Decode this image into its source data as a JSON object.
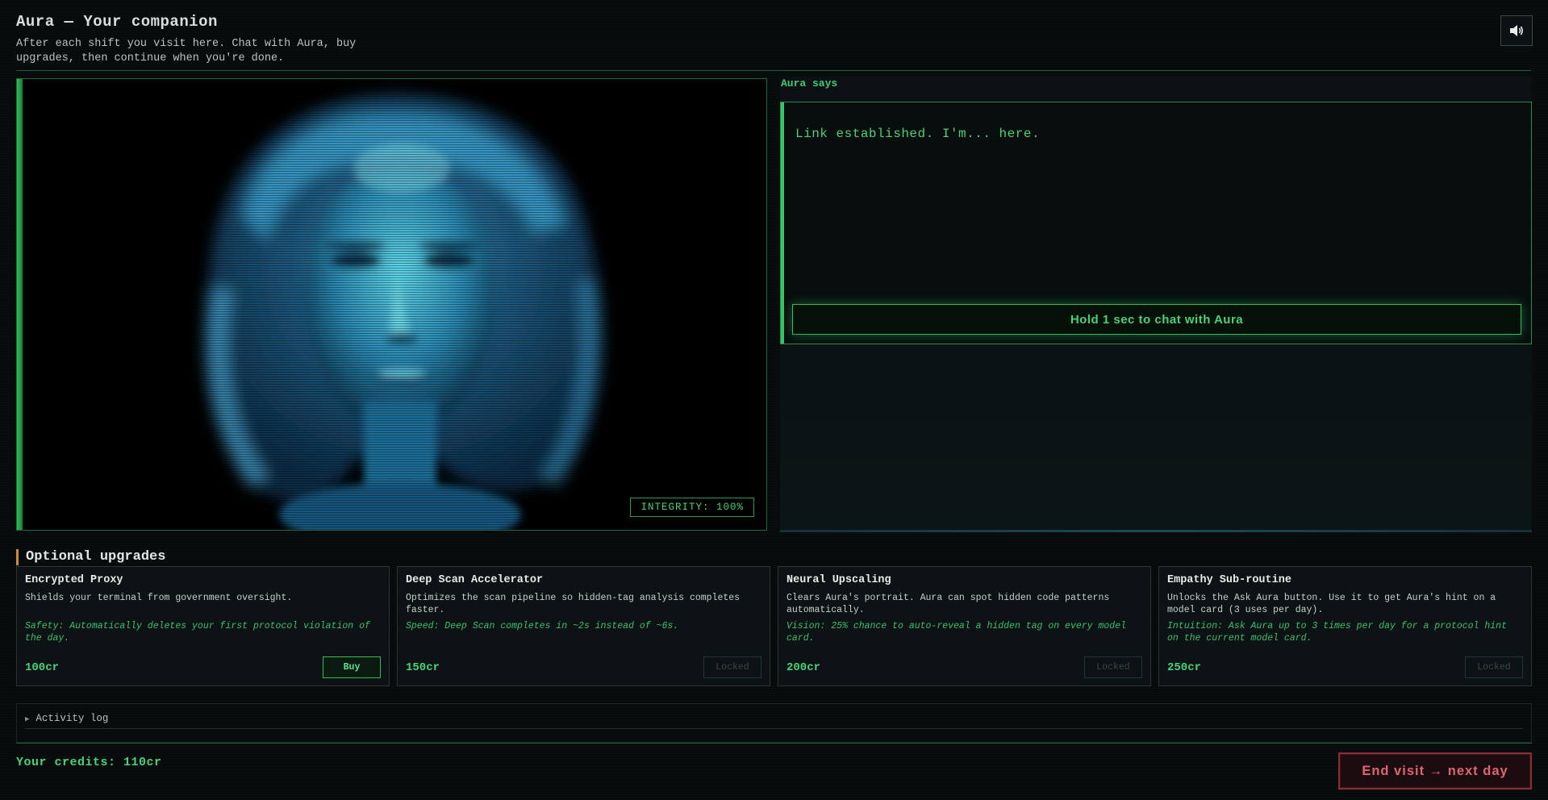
{
  "header": {
    "title": "Aura — Your companion",
    "subtitle": "After each shift you visit here. Chat with Aura, buy upgrades, then continue when you're done.",
    "sound_icon": "speaker-icon"
  },
  "portrait": {
    "integrity_label": "INTEGRITY: 100%"
  },
  "chat": {
    "label": "Aura says",
    "message": "Link established. I'm... here.",
    "hold_button": "Hold 1 sec to chat with Aura"
  },
  "upgrades": {
    "title": "Optional upgrades",
    "items": [
      {
        "name": "Encrypted Proxy",
        "description": "Shields your terminal from government oversight.",
        "effect": "Safety: Automatically deletes your first protocol violation of the day.",
        "price": "100cr",
        "button": "Buy"
      },
      {
        "name": "Deep Scan Accelerator",
        "description": "Optimizes the scan pipeline so hidden-tag analysis completes faster.",
        "effect": "Speed: Deep Scan completes in ~2s instead of ~6s.",
        "price": "150cr",
        "button": "Locked"
      },
      {
        "name": "Neural Upscaling",
        "description": "Clears Aura's portrait. Aura can spot hidden code patterns automatically.",
        "effect": "Vision: 25% chance to auto-reveal a hidden tag on every model card.",
        "price": "200cr",
        "button": "Locked"
      },
      {
        "name": "Empathy Sub-routine",
        "description": "Unlocks the Ask Aura button. Use it to get Aura's hint on a model card (3 uses per day).",
        "effect": "Intuition: Ask Aura up to 3 times per day for a protocol hint on the current model card.",
        "price": "250cr",
        "button": "Locked"
      }
    ]
  },
  "activity_log": {
    "label": "Activity log"
  },
  "footer": {
    "credits": "Your credits: 110cr",
    "end_button": "End visit → next day"
  }
}
